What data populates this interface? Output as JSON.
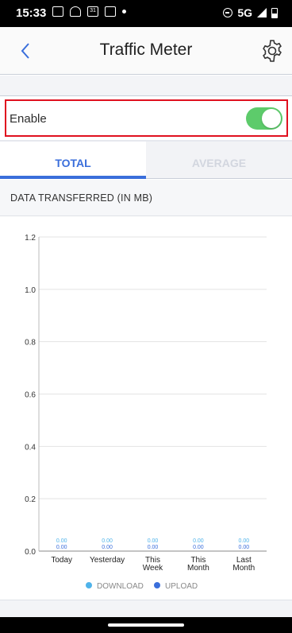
{
  "status_bar": {
    "time": "15:33",
    "network": "5G",
    "icons": [
      "teams-icon",
      "wifi-question-icon",
      "calendar-31-icon",
      "outlook-icon",
      "dot-icon",
      "do-not-disturb-icon",
      "signal-icon",
      "battery-icon"
    ],
    "calendar_day": "31"
  },
  "header": {
    "title": "Traffic Meter",
    "back_icon": "chevron-left-icon",
    "settings_icon": "gear-icon"
  },
  "enable": {
    "label": "Enable",
    "enabled": true,
    "highlight_color": "#e0101f"
  },
  "tabs": [
    {
      "label": "TOTAL",
      "active": true
    },
    {
      "label": "AVERAGE",
      "active": false
    }
  ],
  "section_title": "DATA TRANSFERRED (IN MB)",
  "colors": {
    "accent": "#3a6edb",
    "toggle_on": "#5dcb6b",
    "download": "#4fb3ea",
    "upload": "#3a6edb"
  },
  "chart_data": {
    "type": "bar",
    "categories": [
      "Today",
      "Yesterday",
      "This Week",
      "This Month",
      "Last Month"
    ],
    "series": [
      {
        "name": "DOWNLOAD",
        "values": [
          0.0,
          0.0,
          0.0,
          0.0,
          0.0
        ]
      },
      {
        "name": "UPLOAD",
        "values": [
          0.0,
          0.0,
          0.0,
          0.0,
          0.0
        ]
      }
    ],
    "value_labels": [
      "0.00",
      "0.00",
      "0.00",
      "0.00",
      "0.00"
    ],
    "y_ticks": [
      "0.0",
      "0.2",
      "0.4",
      "0.6",
      "0.8",
      "1.0",
      "1.2"
    ],
    "ylim": [
      0,
      1.2
    ],
    "grid": true,
    "legend_position": "bottom-center",
    "legend": [
      {
        "label": "DOWNLOAD",
        "color": "#4fb3ea"
      },
      {
        "label": "UPLOAD",
        "color": "#3a6edb"
      }
    ]
  }
}
